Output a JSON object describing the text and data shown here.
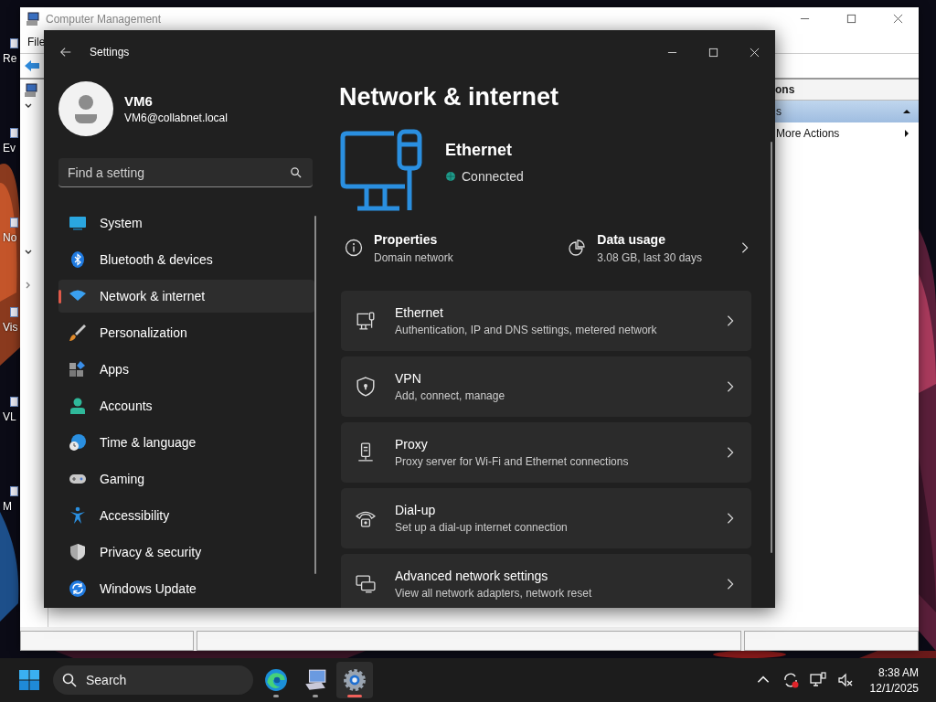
{
  "desktop": {
    "icons": [
      {
        "label": "Re"
      },
      {
        "label": "Ev"
      },
      {
        "label": "No"
      },
      {
        "label": "Vis"
      },
      {
        "label": "VL"
      },
      {
        "label": "M"
      }
    ]
  },
  "background_window": {
    "title": "Computer Management",
    "menu": [
      "File"
    ],
    "actions_pane": {
      "header": "ons",
      "items": [
        {
          "label": "s",
          "selected": true,
          "kind": "group"
        },
        {
          "label": "More Actions",
          "selected": false,
          "kind": "submenu"
        }
      ]
    }
  },
  "settings": {
    "title": "Settings",
    "user": {
      "name": "VM6",
      "email": "VM6@collabnet.local"
    },
    "search": {
      "placeholder": "Find a setting"
    },
    "nav": [
      {
        "label": "System",
        "kind": "system",
        "selected": false
      },
      {
        "label": "Bluetooth & devices",
        "kind": "bluetooth",
        "selected": false
      },
      {
        "label": "Network & internet",
        "kind": "network",
        "selected": true
      },
      {
        "label": "Personalization",
        "kind": "personalization",
        "selected": false
      },
      {
        "label": "Apps",
        "kind": "apps",
        "selected": false
      },
      {
        "label": "Accounts",
        "kind": "accounts",
        "selected": false
      },
      {
        "label": "Time & language",
        "kind": "time",
        "selected": false
      },
      {
        "label": "Gaming",
        "kind": "gaming",
        "selected": false
      },
      {
        "label": "Accessibility",
        "kind": "accessibility",
        "selected": false
      },
      {
        "label": "Privacy & security",
        "kind": "privacy",
        "selected": false
      },
      {
        "label": "Windows Update",
        "kind": "update",
        "selected": false
      }
    ],
    "page_title": "Network & internet",
    "connection": {
      "name": "Ethernet",
      "status": "Connected"
    },
    "summary": [
      {
        "title": "Properties",
        "detail": "Domain network",
        "kind": "info",
        "chevron": false
      },
      {
        "title": "Data usage",
        "detail": "3.08 GB, last 30 days",
        "kind": "pie",
        "chevron": true
      }
    ],
    "cards": [
      {
        "title": "Ethernet",
        "detail": "Authentication, IP and DNS settings, metered network",
        "kind": "ethernet"
      },
      {
        "title": "VPN",
        "detail": "Add, connect, manage",
        "kind": "vpn"
      },
      {
        "title": "Proxy",
        "detail": "Proxy server for Wi-Fi and Ethernet connections",
        "kind": "proxy"
      },
      {
        "title": "Dial-up",
        "detail": "Set up a dial-up internet connection",
        "kind": "dialup"
      },
      {
        "title": "Advanced network settings",
        "detail": "View all network adapters, network reset",
        "kind": "advanced"
      }
    ]
  },
  "taskbar": {
    "search": "Search",
    "apps": [
      {
        "kind": "edge",
        "active": false
      },
      {
        "kind": "management",
        "active": false
      },
      {
        "kind": "settings",
        "active": true
      }
    ],
    "time": "8:38 AM",
    "date": "12/1/2025"
  }
}
